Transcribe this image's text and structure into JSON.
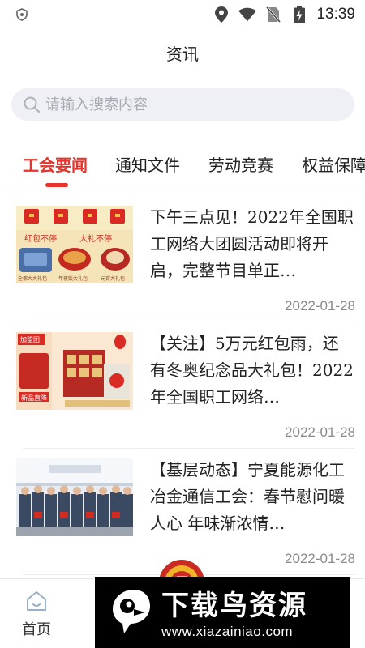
{
  "status_bar": {
    "time": "13:39",
    "icons": [
      "shield-icon",
      "location-icon",
      "wifi-icon",
      "no-sim-icon",
      "battery-charging-icon"
    ]
  },
  "header": {
    "title": "资讯"
  },
  "search": {
    "placeholder": "请输入搜索内容",
    "value": ""
  },
  "tabs": [
    {
      "label": "工会要闻",
      "active": true
    },
    {
      "label": "通知文件",
      "active": false
    },
    {
      "label": "劳动竞赛",
      "active": false
    },
    {
      "label": "权益保障",
      "active": false
    }
  ],
  "news": [
    {
      "title": "下午三点见！2022年全国职工网络大团圆活动即将开启，完整节目单正…",
      "date": "2022-01-28",
      "image_text": [
        "红包不停",
        "大礼不停",
        "全都大大礼包",
        "年夜饭大礼包",
        "元宵大礼包"
      ]
    },
    {
      "title": "【关注】5万元红包雨，还有冬奥纪念品大礼包！2022年全国职工网络…",
      "date": "2022-01-28",
      "image_text": [
        "加盟团",
        "新品直降"
      ]
    },
    {
      "title": "【基层动态】宁夏能源化工冶金通信工会：春节慰问暖人心 年味渐浓情…",
      "date": "2022-01-28",
      "image_text": []
    }
  ],
  "bottom_nav": {
    "items": [
      {
        "label": "首页",
        "icon": "home-icon"
      }
    ]
  },
  "watermark": {
    "title": "下载鸟资源",
    "url": "www.xiazainiao.com"
  },
  "colors": {
    "accent": "#e8342c",
    "search_bg": "#eef0f6",
    "date": "#8a8a8a"
  }
}
